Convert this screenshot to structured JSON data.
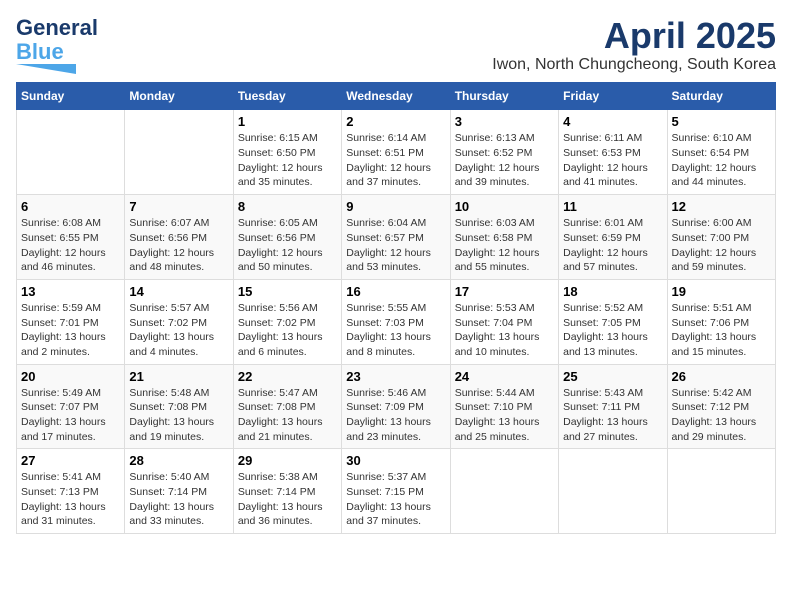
{
  "logo": {
    "line1": "General",
    "line2": "Blue"
  },
  "header": {
    "month": "April 2025",
    "location": "Iwon, North Chungcheong, South Korea"
  },
  "weekdays": [
    "Sunday",
    "Monday",
    "Tuesday",
    "Wednesday",
    "Thursday",
    "Friday",
    "Saturday"
  ],
  "weeks": [
    [
      {
        "day": "",
        "info": ""
      },
      {
        "day": "",
        "info": ""
      },
      {
        "day": "1",
        "info": "Sunrise: 6:15 AM\nSunset: 6:50 PM\nDaylight: 12 hours and 35 minutes."
      },
      {
        "day": "2",
        "info": "Sunrise: 6:14 AM\nSunset: 6:51 PM\nDaylight: 12 hours and 37 minutes."
      },
      {
        "day": "3",
        "info": "Sunrise: 6:13 AM\nSunset: 6:52 PM\nDaylight: 12 hours and 39 minutes."
      },
      {
        "day": "4",
        "info": "Sunrise: 6:11 AM\nSunset: 6:53 PM\nDaylight: 12 hours and 41 minutes."
      },
      {
        "day": "5",
        "info": "Sunrise: 6:10 AM\nSunset: 6:54 PM\nDaylight: 12 hours and 44 minutes."
      }
    ],
    [
      {
        "day": "6",
        "info": "Sunrise: 6:08 AM\nSunset: 6:55 PM\nDaylight: 12 hours and 46 minutes."
      },
      {
        "day": "7",
        "info": "Sunrise: 6:07 AM\nSunset: 6:56 PM\nDaylight: 12 hours and 48 minutes."
      },
      {
        "day": "8",
        "info": "Sunrise: 6:05 AM\nSunset: 6:56 PM\nDaylight: 12 hours and 50 minutes."
      },
      {
        "day": "9",
        "info": "Sunrise: 6:04 AM\nSunset: 6:57 PM\nDaylight: 12 hours and 53 minutes."
      },
      {
        "day": "10",
        "info": "Sunrise: 6:03 AM\nSunset: 6:58 PM\nDaylight: 12 hours and 55 minutes."
      },
      {
        "day": "11",
        "info": "Sunrise: 6:01 AM\nSunset: 6:59 PM\nDaylight: 12 hours and 57 minutes."
      },
      {
        "day": "12",
        "info": "Sunrise: 6:00 AM\nSunset: 7:00 PM\nDaylight: 12 hours and 59 minutes."
      }
    ],
    [
      {
        "day": "13",
        "info": "Sunrise: 5:59 AM\nSunset: 7:01 PM\nDaylight: 13 hours and 2 minutes."
      },
      {
        "day": "14",
        "info": "Sunrise: 5:57 AM\nSunset: 7:02 PM\nDaylight: 13 hours and 4 minutes."
      },
      {
        "day": "15",
        "info": "Sunrise: 5:56 AM\nSunset: 7:02 PM\nDaylight: 13 hours and 6 minutes."
      },
      {
        "day": "16",
        "info": "Sunrise: 5:55 AM\nSunset: 7:03 PM\nDaylight: 13 hours and 8 minutes."
      },
      {
        "day": "17",
        "info": "Sunrise: 5:53 AM\nSunset: 7:04 PM\nDaylight: 13 hours and 10 minutes."
      },
      {
        "day": "18",
        "info": "Sunrise: 5:52 AM\nSunset: 7:05 PM\nDaylight: 13 hours and 13 minutes."
      },
      {
        "day": "19",
        "info": "Sunrise: 5:51 AM\nSunset: 7:06 PM\nDaylight: 13 hours and 15 minutes."
      }
    ],
    [
      {
        "day": "20",
        "info": "Sunrise: 5:49 AM\nSunset: 7:07 PM\nDaylight: 13 hours and 17 minutes."
      },
      {
        "day": "21",
        "info": "Sunrise: 5:48 AM\nSunset: 7:08 PM\nDaylight: 13 hours and 19 minutes."
      },
      {
        "day": "22",
        "info": "Sunrise: 5:47 AM\nSunset: 7:08 PM\nDaylight: 13 hours and 21 minutes."
      },
      {
        "day": "23",
        "info": "Sunrise: 5:46 AM\nSunset: 7:09 PM\nDaylight: 13 hours and 23 minutes."
      },
      {
        "day": "24",
        "info": "Sunrise: 5:44 AM\nSunset: 7:10 PM\nDaylight: 13 hours and 25 minutes."
      },
      {
        "day": "25",
        "info": "Sunrise: 5:43 AM\nSunset: 7:11 PM\nDaylight: 13 hours and 27 minutes."
      },
      {
        "day": "26",
        "info": "Sunrise: 5:42 AM\nSunset: 7:12 PM\nDaylight: 13 hours and 29 minutes."
      }
    ],
    [
      {
        "day": "27",
        "info": "Sunrise: 5:41 AM\nSunset: 7:13 PM\nDaylight: 13 hours and 31 minutes."
      },
      {
        "day": "28",
        "info": "Sunrise: 5:40 AM\nSunset: 7:14 PM\nDaylight: 13 hours and 33 minutes."
      },
      {
        "day": "29",
        "info": "Sunrise: 5:38 AM\nSunset: 7:14 PM\nDaylight: 13 hours and 36 minutes."
      },
      {
        "day": "30",
        "info": "Sunrise: 5:37 AM\nSunset: 7:15 PM\nDaylight: 13 hours and 37 minutes."
      },
      {
        "day": "",
        "info": ""
      },
      {
        "day": "",
        "info": ""
      },
      {
        "day": "",
        "info": ""
      }
    ]
  ]
}
